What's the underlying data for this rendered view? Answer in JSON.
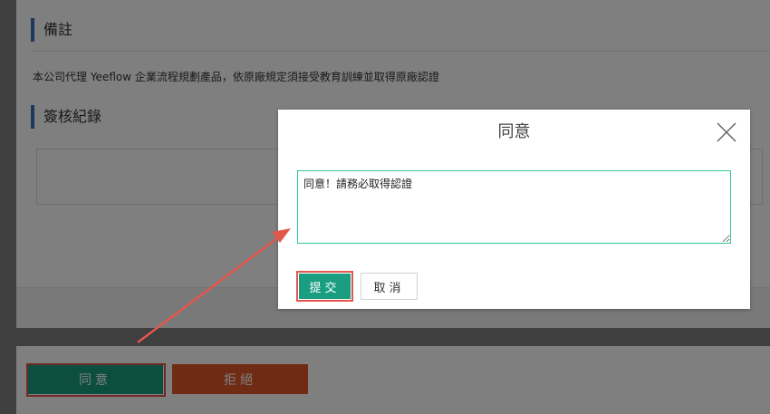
{
  "page": {
    "remarks_title": "備註",
    "remarks_text": "本公司代理 Yeeflow 企業流程規劃產品，依原廠規定須接受教育訓練並取得原廠認證",
    "approval_log_title": "簽核紀錄"
  },
  "actions": {
    "agree_label": "同意",
    "reject_label": "拒絕"
  },
  "modal": {
    "title": "同意",
    "comment_value": "同意！請務必取得認證",
    "submit_label": "提交",
    "cancel_label": "取消"
  },
  "colors": {
    "accent_green": "#199e82",
    "reject_orange": "#e0562a",
    "highlight_red": "#e2574c",
    "section_bar_blue": "#3b73b9",
    "input_border": "#2ec49e"
  }
}
